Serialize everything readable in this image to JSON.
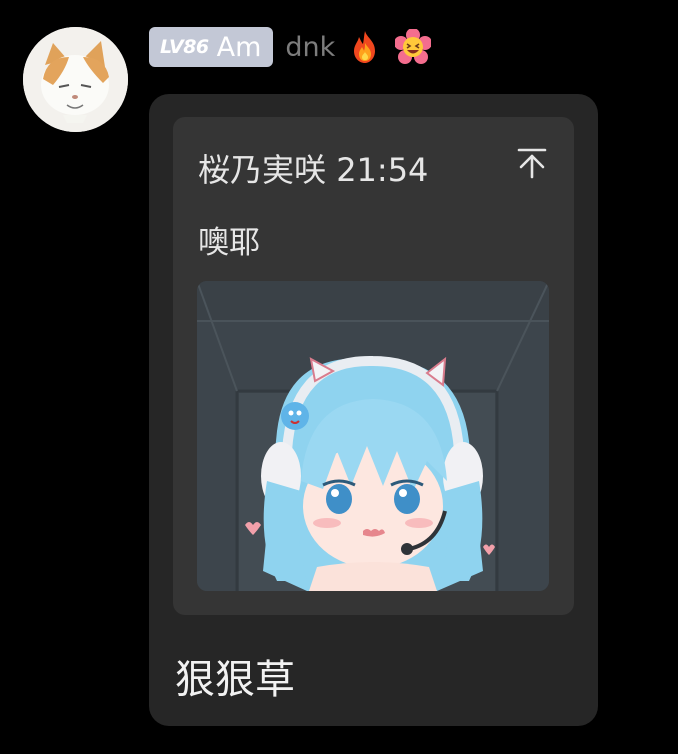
{
  "sender": {
    "level_badge": "LV86",
    "role_title": "Am",
    "name": "dnk",
    "decorations": [
      "fire-icon",
      "laughing-flower-icon"
    ],
    "badge_color": "#c3c8d6"
  },
  "message": {
    "quote": {
      "author": "桜乃実咲",
      "time": "21:54",
      "text": "噢耶",
      "jump_icon": "jump-to-top-icon",
      "image_icon": "anime-girl-sticker"
    },
    "text": "狠狠草"
  },
  "colors": {
    "background": "#000000",
    "bubble": "#262626",
    "quote_card": "#353535",
    "username": "#7d7d7d"
  }
}
